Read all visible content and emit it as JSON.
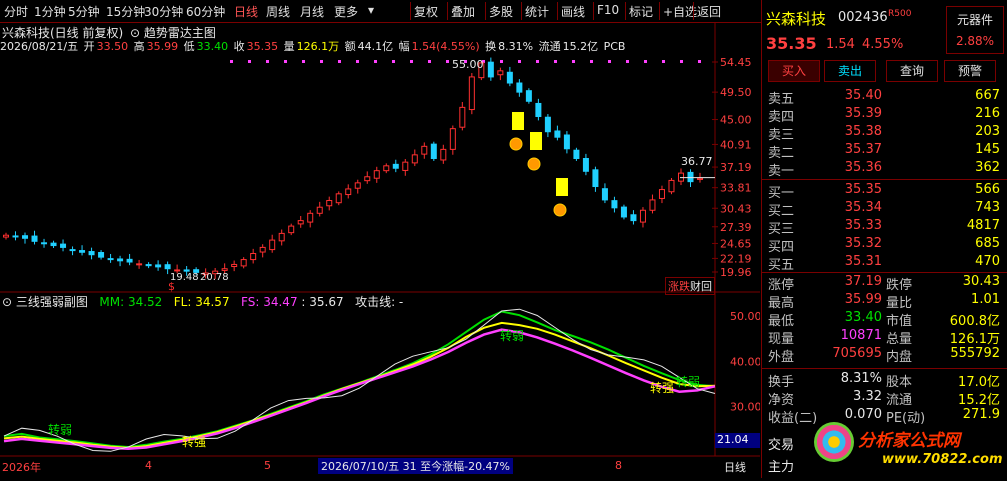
{
  "toolbar": {
    "periods": [
      "分时",
      "1分钟",
      "5分钟",
      "15分钟",
      "30分钟",
      "60分钟",
      "日线",
      "周线",
      "月线",
      "更多"
    ],
    "active_period": "日线",
    "actions": [
      "复权",
      "叠加",
      "多股",
      "统计",
      "画线",
      "F10",
      "标记",
      "+自选",
      "返回"
    ]
  },
  "chart_info": {
    "date": "2026/08/21/五",
    "open_label": "开",
    "open": "33.50",
    "high_label": "高",
    "high": "35.99",
    "low_label": "低",
    "low": "33.40",
    "close_label": "收",
    "close": "35.35",
    "vol_label": "量",
    "vol": "126.1万",
    "amount_label": "额",
    "amount": "44.1亿",
    "change_label": "幅",
    "change": "1.54(4.55%)",
    "turnover_label": "换",
    "turnover": "8.31%",
    "float_label": "流通",
    "float": "15.2亿",
    "tag": "PCB"
  },
  "main_chart": {
    "title": "兴森科技(日线 前复权)",
    "indicator": "趋势雷达主图",
    "y_labels": [
      "54.45",
      "49.50",
      "45.00",
      "40.91",
      "37.19",
      "33.81",
      "30.43",
      "27.39",
      "24.65",
      "22.19",
      "19.96"
    ],
    "ann_high": "55.00",
    "ann_low": "19.48",
    "ann_low2": "20.78",
    "ann_last": "36.77",
    "corner_btns": [
      "涨跌",
      "财",
      "回"
    ]
  },
  "sub_chart": {
    "title": "三线强弱副图",
    "mm_label": "MM:",
    "mm": "34.52",
    "fl_label": "FL:",
    "fl": "34.57",
    "fs_label": "FS:",
    "fs": "34.47",
    "extra": ": 35.67",
    "attack": "攻击线: -",
    "y_labels": [
      "50.00",
      "40.00",
      "30.00"
    ],
    "current": "21.04",
    "signals": [
      "转弱",
      "转强",
      "转弱",
      "转强",
      "转弱"
    ]
  },
  "bottom_axis": {
    "year": "2026年",
    "months": [
      "4",
      "5",
      "8"
    ],
    "range_text": "2026/07/10/五 31 至今涨幅-20.47%",
    "period": "日线"
  },
  "quote": {
    "name": "兴森科技",
    "code": "002436",
    "badge": "R500",
    "tag": "元器件",
    "tag_pct": "2.88%",
    "price": "35.35",
    "chg": "1.54",
    "chg_pct": "4.55%",
    "buttons": [
      "买入",
      "卖出",
      "查询",
      "预警"
    ],
    "asks": [
      {
        "label": "卖五",
        "price": "35.40",
        "vol": "667"
      },
      {
        "label": "卖四",
        "price": "35.39",
        "vol": "216"
      },
      {
        "label": "卖三",
        "price": "35.38",
        "vol": "203"
      },
      {
        "label": "卖二",
        "price": "35.37",
        "vol": "145"
      },
      {
        "label": "卖一",
        "price": "35.36",
        "vol": "362"
      }
    ],
    "bids": [
      {
        "label": "买一",
        "price": "35.35",
        "vol": "566"
      },
      {
        "label": "买二",
        "price": "35.34",
        "vol": "743"
      },
      {
        "label": "买三",
        "price": "35.33",
        "vol": "4817"
      },
      {
        "label": "买四",
        "price": "35.32",
        "vol": "685"
      },
      {
        "label": "买五",
        "price": "35.31",
        "vol": "470"
      }
    ],
    "stats": [
      {
        "l1": "涨停",
        "v1": "37.19",
        "l2": "跌停",
        "v2": "30.43"
      },
      {
        "l1": "最高",
        "v1": "35.99",
        "l2": "量比",
        "v2": "1.01"
      },
      {
        "l1": "最低",
        "v1": "33.40",
        "l2": "市值",
        "v2": "600.8亿"
      },
      {
        "l1": "现量",
        "v1": "10871",
        "l2": "总量",
        "v2": "126.1万"
      },
      {
        "l1": "外盘",
        "v1": "705695",
        "l2": "内盘",
        "v2": "555792"
      }
    ],
    "stats2": [
      {
        "l1": "换手",
        "v1": "8.31%",
        "l2": "股本",
        "v2": "17.0亿"
      },
      {
        "l1": "净资",
        "v1": "3.32",
        "l2": "流通",
        "v2": "15.2亿"
      },
      {
        "l1": "收益(二)",
        "v1": "0.070",
        "l2": "PE(动)",
        "v2": "271.9"
      }
    ],
    "footer": [
      "交易",
      "主力"
    ],
    "logo_text": "分析家公式网",
    "logo_url": "www.70822.com"
  },
  "chart_data": {
    "type": "line",
    "title": "兴森科技(日线 前复权)",
    "candles_close": [
      26.0,
      25.8,
      25.5,
      25.0,
      24.7,
      24.3,
      24.0,
      23.6,
      23.2,
      22.8,
      22.4,
      22.1,
      21.8,
      21.6,
      21.3,
      21.0,
      20.8,
      20.5,
      20.3,
      20.1,
      19.9,
      19.8,
      20.1,
      20.5,
      21.2,
      22.0,
      23.0,
      24.0,
      25.2,
      26.3,
      27.5,
      28.4,
      29.6,
      30.6,
      31.7,
      32.8,
      33.6,
      34.6,
      35.6,
      36.6,
      37.4,
      37.0,
      38.0,
      39.2,
      40.6,
      38.6,
      40.1,
      43.5,
      47.0,
      52.0,
      54.3,
      52.0,
      53.0,
      51.0,
      49.5,
      48.0,
      45.5,
      43.0,
      42.1,
      40.2,
      38.6,
      36.5,
      34.0,
      31.8,
      30.5,
      29.0,
      28.4,
      30.1,
      31.8,
      33.5,
      35.0,
      36.2,
      34.8,
      35.35
    ],
    "series": [
      {
        "name": "MM",
        "values": [
          23.5,
          24.0,
          23.2,
          22.8,
          22.4,
          21.9,
          21.4,
          21.1,
          21.6,
          22.3,
          22.9,
          23.7,
          24.6,
          25.8,
          27.0,
          28.4,
          29.8,
          31.2,
          32.7,
          34.0,
          35.3,
          36.7,
          38.1,
          39.6,
          41.5,
          43.8,
          46.5,
          49.2,
          51.0,
          50.2,
          48.6,
          46.9,
          45.6,
          44.2,
          42.6,
          40.8,
          39.0,
          37.4,
          35.9,
          34.8,
          34.5
        ]
      },
      {
        "name": "FL",
        "values": [
          23.0,
          23.4,
          22.9,
          22.5,
          22.1,
          21.6,
          21.2,
          20.9,
          21.3,
          22.0,
          22.7,
          23.5,
          24.4,
          25.6,
          26.9,
          28.2,
          29.6,
          31.0,
          32.5,
          33.9,
          35.2,
          36.5,
          37.9,
          39.3,
          41.0,
          43.0,
          45.4,
          47.4,
          48.5,
          48.0,
          47.2,
          45.9,
          44.4,
          42.9,
          41.3,
          39.6,
          38.0,
          36.4,
          35.0,
          34.5,
          34.6
        ]
      },
      {
        "name": "FS",
        "values": [
          22.4,
          22.9,
          22.5,
          22.1,
          21.7,
          21.3,
          20.9,
          20.7,
          21.0,
          21.7,
          22.4,
          23.2,
          24.1,
          25.3,
          26.6,
          28.0,
          29.4,
          30.8,
          32.3,
          33.7,
          35.0,
          36.3,
          37.6,
          38.9,
          40.4,
          42.1,
          44.1,
          45.9,
          47.0,
          46.4,
          45.3,
          43.9,
          42.4,
          40.8,
          39.1,
          37.4,
          35.8,
          34.4,
          33.3,
          33.6,
          34.5
        ]
      }
    ],
    "ylim_main": [
      19.96,
      54.45
    ],
    "ylim_sub": [
      20,
      52
    ]
  }
}
